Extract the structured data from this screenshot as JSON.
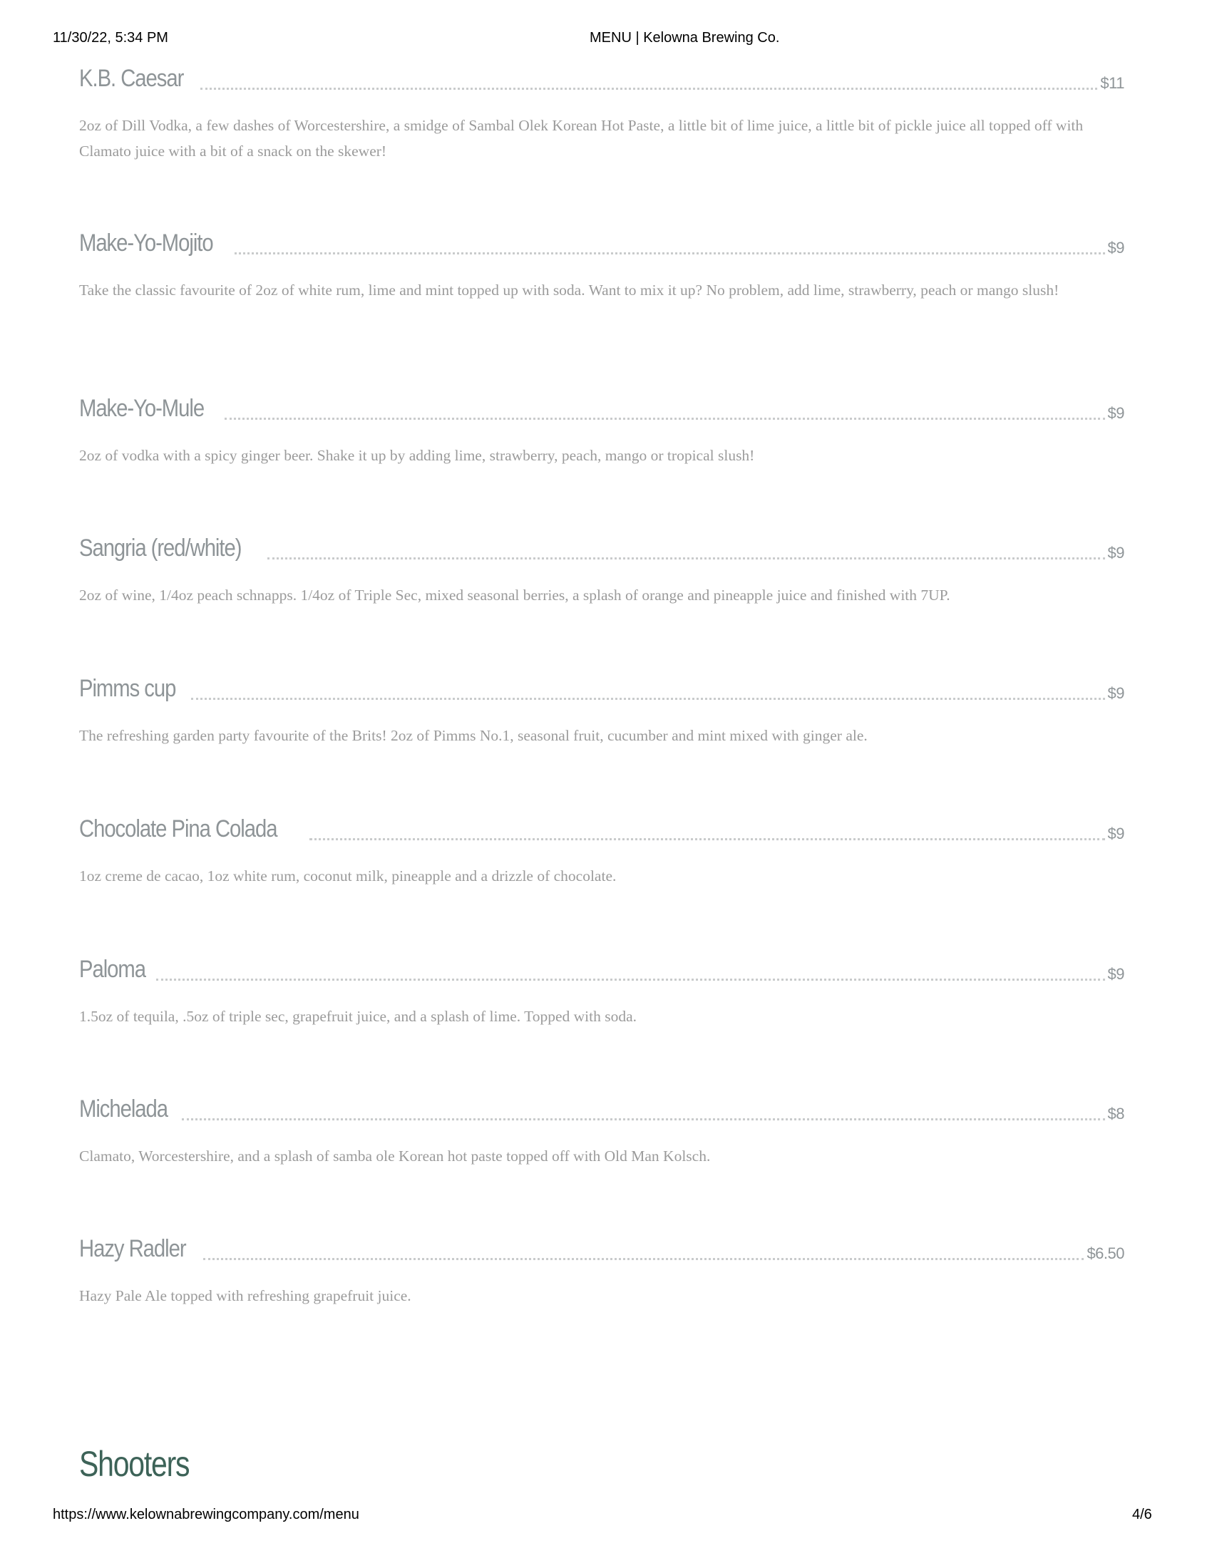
{
  "print_header": {
    "datetime": "11/30/22, 5:34 PM",
    "title": "MENU | Kelowna Brewing Co."
  },
  "items": [
    {
      "name": "K.B. Caesar",
      "price": "$11",
      "description": "2oz of Dill Vodka, a few dashes of Worcestershire, a smidge of Sambal Olek Korean Hot Paste, a little bit of lime juice, a little bit of pickle juice all topped off with Clamato juice with a bit of a snack on the skewer!"
    },
    {
      "name": "Make-Yo-Mojito",
      "price": "$9",
      "description": "Take the classic favourite of 2oz of white rum, lime and mint topped up with soda. Want to mix it up? No problem, add lime, strawberry, peach or mango slush!"
    },
    {
      "name": "Make-Yo-Mule",
      "price": "$9",
      "description": "2oz of vodka with a spicy ginger beer. Shake it up by adding lime, strawberry, peach, mango or tropical slush!"
    },
    {
      "name": "Sangria (red/white)",
      "price": "$9",
      "description": "2oz of wine, 1/4oz peach schnapps. 1/4oz of Triple Sec, mixed seasonal berries, a splash of orange and pineapple juice and finished with 7UP."
    },
    {
      "name": "Pimms cup",
      "price": "$9",
      "description": "The refreshing garden party favourite of the Brits! 2oz of Pimms No.1, seasonal fruit, cucumber and mint mixed with ginger ale."
    },
    {
      "name": "Chocolate Pina Colada",
      "price": "$9",
      "description": "1oz creme de cacao, 1oz white rum, coconut milk, pineapple and a drizzle of chocolate."
    },
    {
      "name": "Paloma",
      "price": "$9",
      "description": "1.5oz of tequila, .5oz of triple sec, grapefruit juice, and a splash of lime. Topped with soda."
    },
    {
      "name": "Michelada",
      "price": "$8",
      "description": "Clamato, Worcestershire, and a splash of samba ole Korean hot paste topped off with Old Man Kolsch."
    },
    {
      "name": "Hazy Radler",
      "price": "$6.50",
      "description": "Hazy Pale Ale topped with refreshing grapefruit juice."
    }
  ],
  "section_heading": "Shooters",
  "print_footer": {
    "url": "https://www.kelownabrewingcompany.com/menu",
    "page": "4/6"
  },
  "colors": {
    "item_title": "#8e9497",
    "description": "#9b9b9b",
    "section_heading": "#3d6358"
  }
}
